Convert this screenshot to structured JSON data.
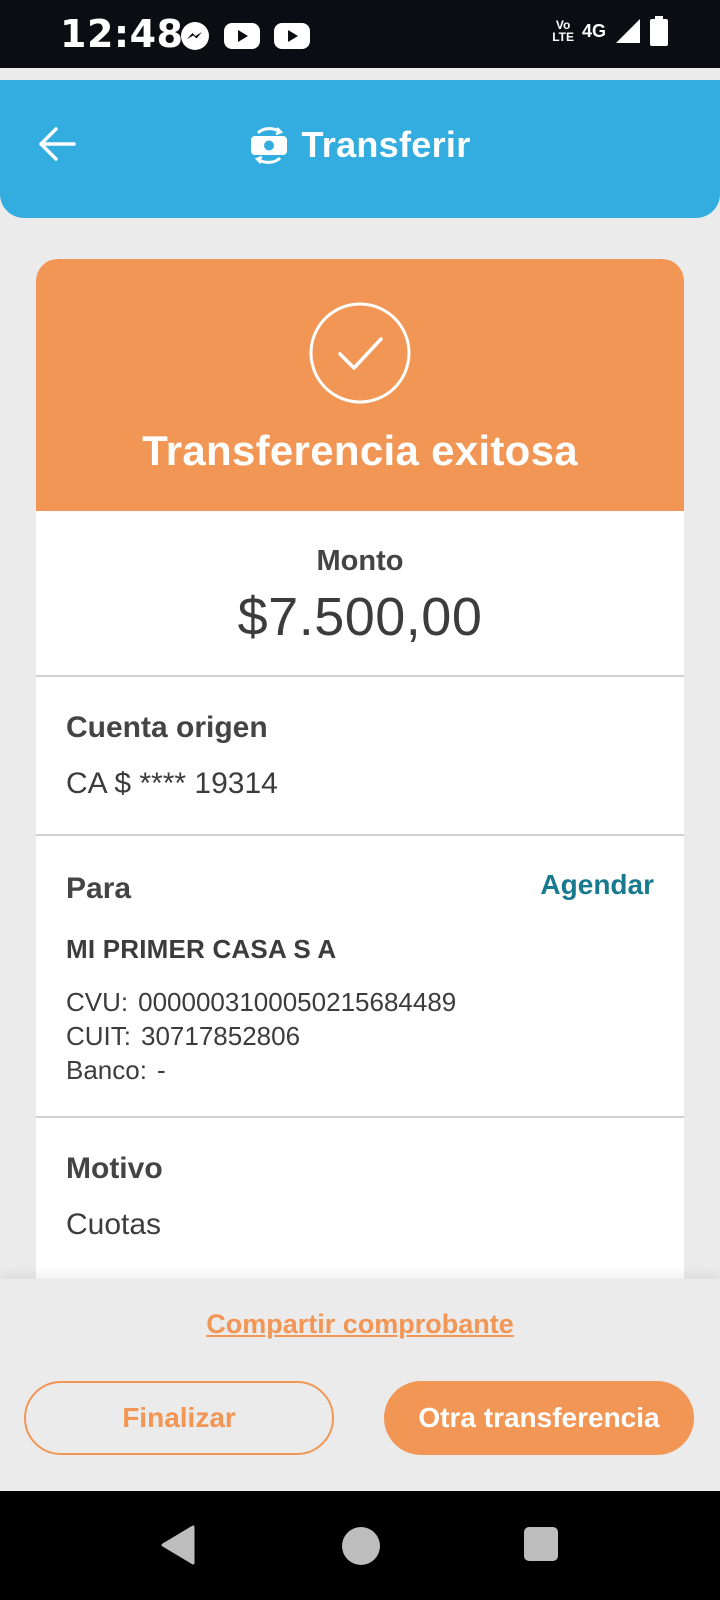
{
  "status_bar": {
    "time": "12:48",
    "left_icons": [
      "messenger-icon",
      "youtube-icon",
      "youtube-icon"
    ],
    "volte_top": "Vo",
    "volte_bottom": "LTE",
    "network": "4G",
    "right_icons": [
      "signal-icon",
      "battery-icon"
    ]
  },
  "app_bar": {
    "title": "Transferir",
    "back_icon": "arrow-left-icon",
    "title_icon": "money-transfer-icon"
  },
  "receipt": {
    "success_title": "Transferencia exitosa",
    "amount_label": "Monto",
    "amount_value": "$7.500,00",
    "origin_label": "Cuenta origen",
    "origin_value": "CA $ **** 19314",
    "para_label": "Para",
    "agendar_label": "Agendar",
    "recipient_name": "MI PRIMER CASA S A",
    "cvu_label": "CVU:",
    "cvu_value": "0000003100050215684489",
    "cuit_label": "CUIT:",
    "cuit_value": "30717852806",
    "banco_label": "Banco:",
    "banco_value": "-",
    "motivo_label": "Motivo",
    "motivo_value": "Cuotas"
  },
  "actions": {
    "share_label": "Compartir comprobante",
    "finish_label": "Finalizar",
    "another_label": "Otra transferencia"
  },
  "colors": {
    "primary_blue": "#33ade0",
    "accent_orange": "#f29656",
    "link_teal": "#187a8e"
  }
}
